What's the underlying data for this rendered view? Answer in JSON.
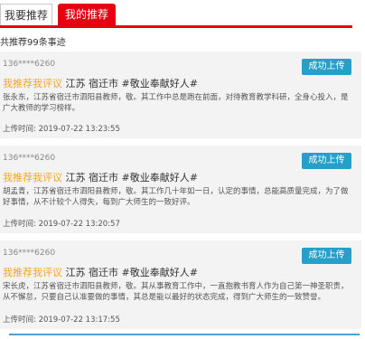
{
  "tabs": {
    "inactive_label": "我要推荐",
    "active_label": "我的推荐"
  },
  "summary": "共推荐99条事迹",
  "cards": [
    {
      "phone": "136****6260",
      "tag": "我推荐我评议",
      "title_rest": "江苏 宿迁市 #敬业奉献好人#",
      "body": "张永东，江苏省宿迁市泗阳县教师，敬。其工作中总是跑在前面，对待教育教学科研，全身心投入，是广大教师的学习榜样。",
      "time_label": "上传时间:",
      "time_value": "2019-07-22 13:23:55",
      "button": "成功上传"
    },
    {
      "phone": "136****6260",
      "tag": "我推荐我评议",
      "title_rest": "江苏 宿迁市 #敬业奉献好人#",
      "body": "胡孟青，江苏省宿迁市泗阳县教师，敬。其工作几十年如一日，认定的事情，总能高质量完成，为了做好事情，从不计较个人得失，每到广大师生的一致好评。",
      "time_label": "上传时间:",
      "time_value": "2019-07-22 13:20:57",
      "button": "成功上传"
    },
    {
      "phone": "136****6260",
      "tag": "我推荐我评议",
      "title_rest": "江苏 宿迁市 #敬业奉献好人#",
      "body": "宋长虎，江苏省宿迁市泗阳县教师，敬。其从事教育工作中，一直抱教书育人作为自己第一神圣职责，从不懈怠，只要自己认准要做的事情，其总是能以最好的状态完成，得到广大师生的一致赞誉。",
      "time_label": "上传时间:",
      "time_value": "2019-07-22 13:17:55",
      "button": "成功上传"
    }
  ]
}
